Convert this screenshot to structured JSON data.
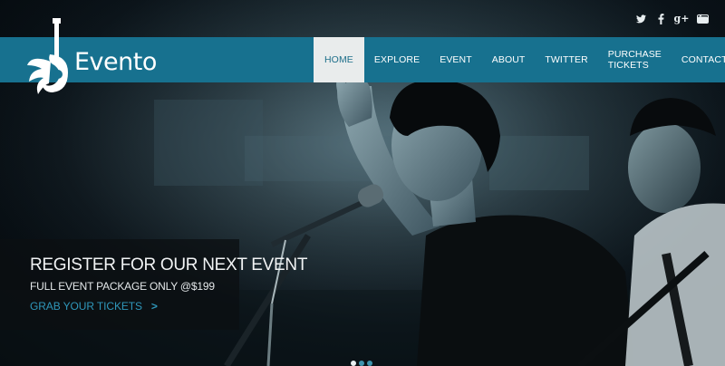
{
  "brand": {
    "name": "Evento"
  },
  "social": {
    "twitter": "t",
    "facebook": "f",
    "googleplus": "g+",
    "youtube": "You"
  },
  "nav": {
    "items": [
      {
        "label": "HOME",
        "active": true
      },
      {
        "label": "EXPLORE"
      },
      {
        "label": "EVENT"
      },
      {
        "label": "ABOUT"
      },
      {
        "label": "TWITTER"
      },
      {
        "label": "PURCHASE TICKETS"
      },
      {
        "label": "CONTACT"
      }
    ]
  },
  "hero": {
    "title": "REGISTER FOR OUR NEXT EVENT",
    "subtitle": "FULL EVENT PACKAGE ONLY @$199",
    "cta": "GRAB YOUR TICKETS",
    "cta_chevron": ">"
  },
  "slider": {
    "total": 3,
    "active_index": 0
  },
  "colors": {
    "accent": "#17718f",
    "link": "#2f97ba",
    "active_nav_bg": "#e9ecec"
  },
  "icons": [
    "twitter-icon",
    "facebook-icon",
    "googleplus-icon",
    "youtube-icon",
    "guitar-logo-icon",
    "chevron-right-icon"
  ]
}
